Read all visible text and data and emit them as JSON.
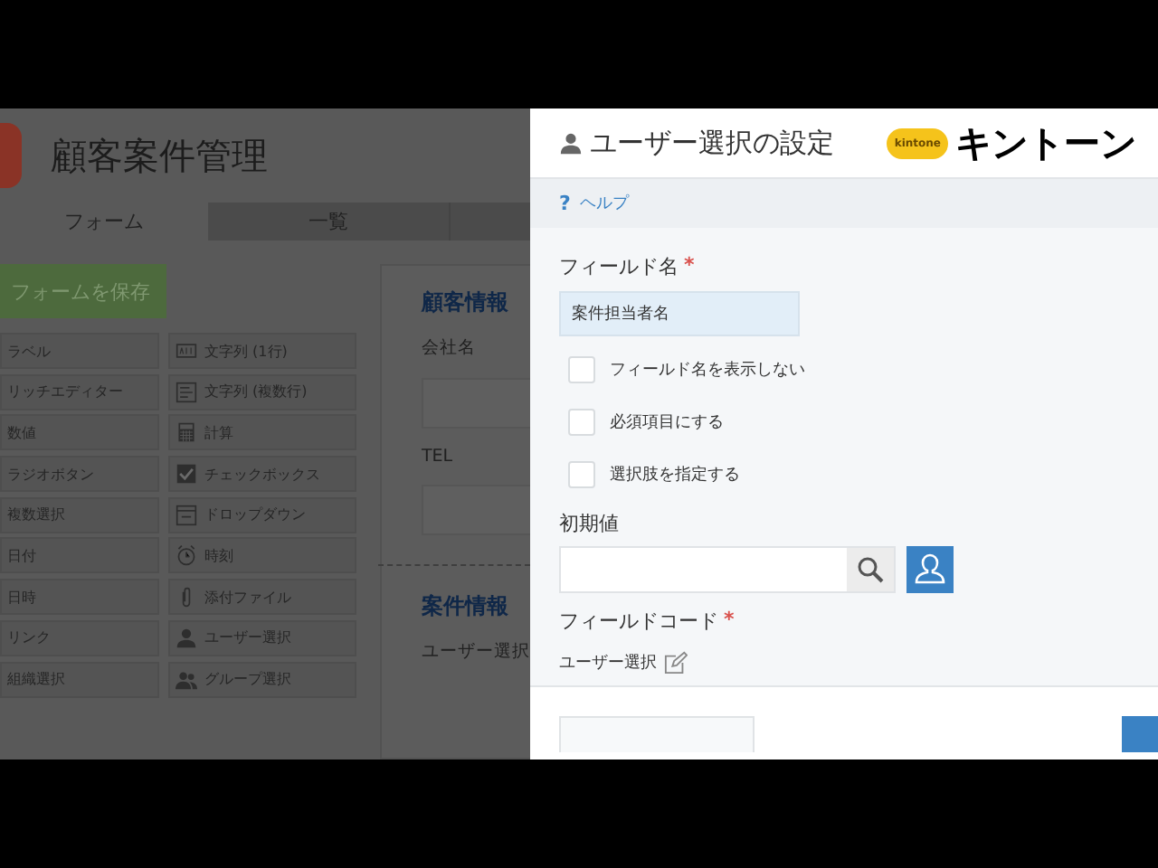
{
  "app": {
    "title": "顧客案件管理"
  },
  "tabs": [
    {
      "label": "フォーム",
      "selected": true
    },
    {
      "label": "一覧",
      "selected": false
    }
  ],
  "save_button": "フォームを保存",
  "palette_left": [
    "ラベル",
    "リッチエディター",
    "数値",
    "ラジオボタン",
    "複数選択",
    "日付",
    "日時",
    "リンク",
    "組織選択"
  ],
  "palette_right": [
    {
      "label": "文字列 (1行)",
      "kind": "abc"
    },
    {
      "label": "文字列 (複数行)",
      "kind": "lines"
    },
    {
      "label": "計算",
      "kind": "calc"
    },
    {
      "label": "チェックボックス",
      "kind": "check"
    },
    {
      "label": "ドロップダウン",
      "kind": "dropdown"
    },
    {
      "label": "時刻",
      "kind": "clock"
    },
    {
      "label": "添付ファイル",
      "kind": "clip"
    },
    {
      "label": "ユーザー選択",
      "kind": "user"
    },
    {
      "label": "グループ選択",
      "kind": "group"
    }
  ],
  "canvas": {
    "sections": [
      {
        "title": "顧客情報",
        "fields": [
          {
            "label": "会社名",
            "kind": "input"
          },
          {
            "label": "TEL",
            "kind": "input"
          }
        ]
      },
      {
        "title": "案件情報",
        "fields": [
          {
            "label": "ユーザー選択",
            "kind": "label"
          }
        ]
      }
    ]
  },
  "dialog": {
    "title": "ユーザー選択の設定",
    "help_icon": "?",
    "help": "ヘルプ",
    "field_name": {
      "label": "フィールド名",
      "required": "*",
      "value": "案件担当者名"
    },
    "options": [
      {
        "label": "フィールド名を表示しない",
        "checked": false
      },
      {
        "label": "必須項目にする",
        "checked": false
      },
      {
        "label": "選択肢を指定する",
        "checked": false
      }
    ],
    "default_label": "初期値",
    "field_code": {
      "label": "フィールドコード",
      "required": "*",
      "value": "ユーザー選択"
    }
  },
  "logo": {
    "badge": "kintone",
    "text": "キントーン"
  }
}
